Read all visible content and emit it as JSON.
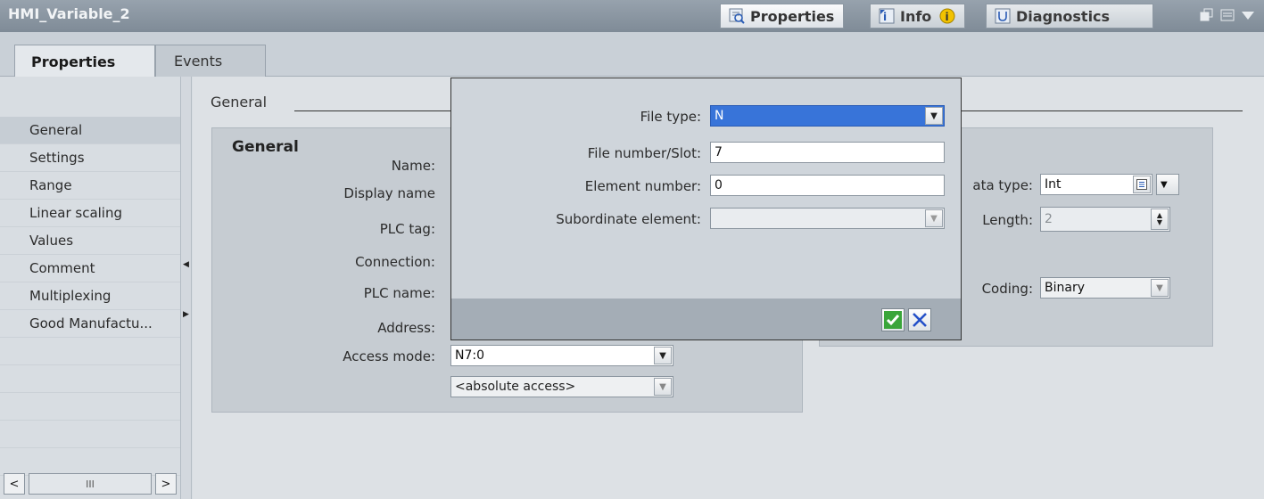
{
  "window": {
    "title": "HMI_Variable_2",
    "tabs": [
      {
        "label": "Properties",
        "icon": "properties-icon"
      },
      {
        "label": "Info",
        "icon": "info-icon"
      },
      {
        "label": "Diagnostics",
        "icon": "diagnostics-icon"
      }
    ]
  },
  "tabs": [
    {
      "label": "Properties"
    },
    {
      "label": "Events"
    }
  ],
  "nav": {
    "items": [
      "General",
      "Settings",
      "Range",
      "Linear scaling",
      "Values",
      "Comment",
      "Multiplexing",
      "Good Manufactu..."
    ]
  },
  "section": {
    "title": "General"
  },
  "group": {
    "title": "General",
    "labels": {
      "name": "Name:",
      "display_name": "Display name",
      "plc_tag": "PLC tag:",
      "connection": "Connection:",
      "plc_name": "PLC name:",
      "address": "Address:",
      "access_mode": "Access mode:"
    },
    "address_value": "N7:0",
    "access_mode_value": "<absolute access>"
  },
  "right_group": {
    "data_type_label": "ata type:",
    "data_type_value": "Int",
    "length_label": "Length:",
    "length_value": "2",
    "coding_label": "Coding:",
    "coding_value": "Binary"
  },
  "popup": {
    "file_type_label": "File type:",
    "file_type_value": "N",
    "file_number_label": "File number/Slot:",
    "file_number_value": "7",
    "element_number_label": "Element number:",
    "element_number_value": "0",
    "subordinate_label": "Subordinate element:",
    "subordinate_value": ""
  },
  "colors": {
    "accent": "#3874d9",
    "titlebar": "#8a95a1",
    "confirm": "#3aa53a",
    "cancel": "#2450c8"
  }
}
